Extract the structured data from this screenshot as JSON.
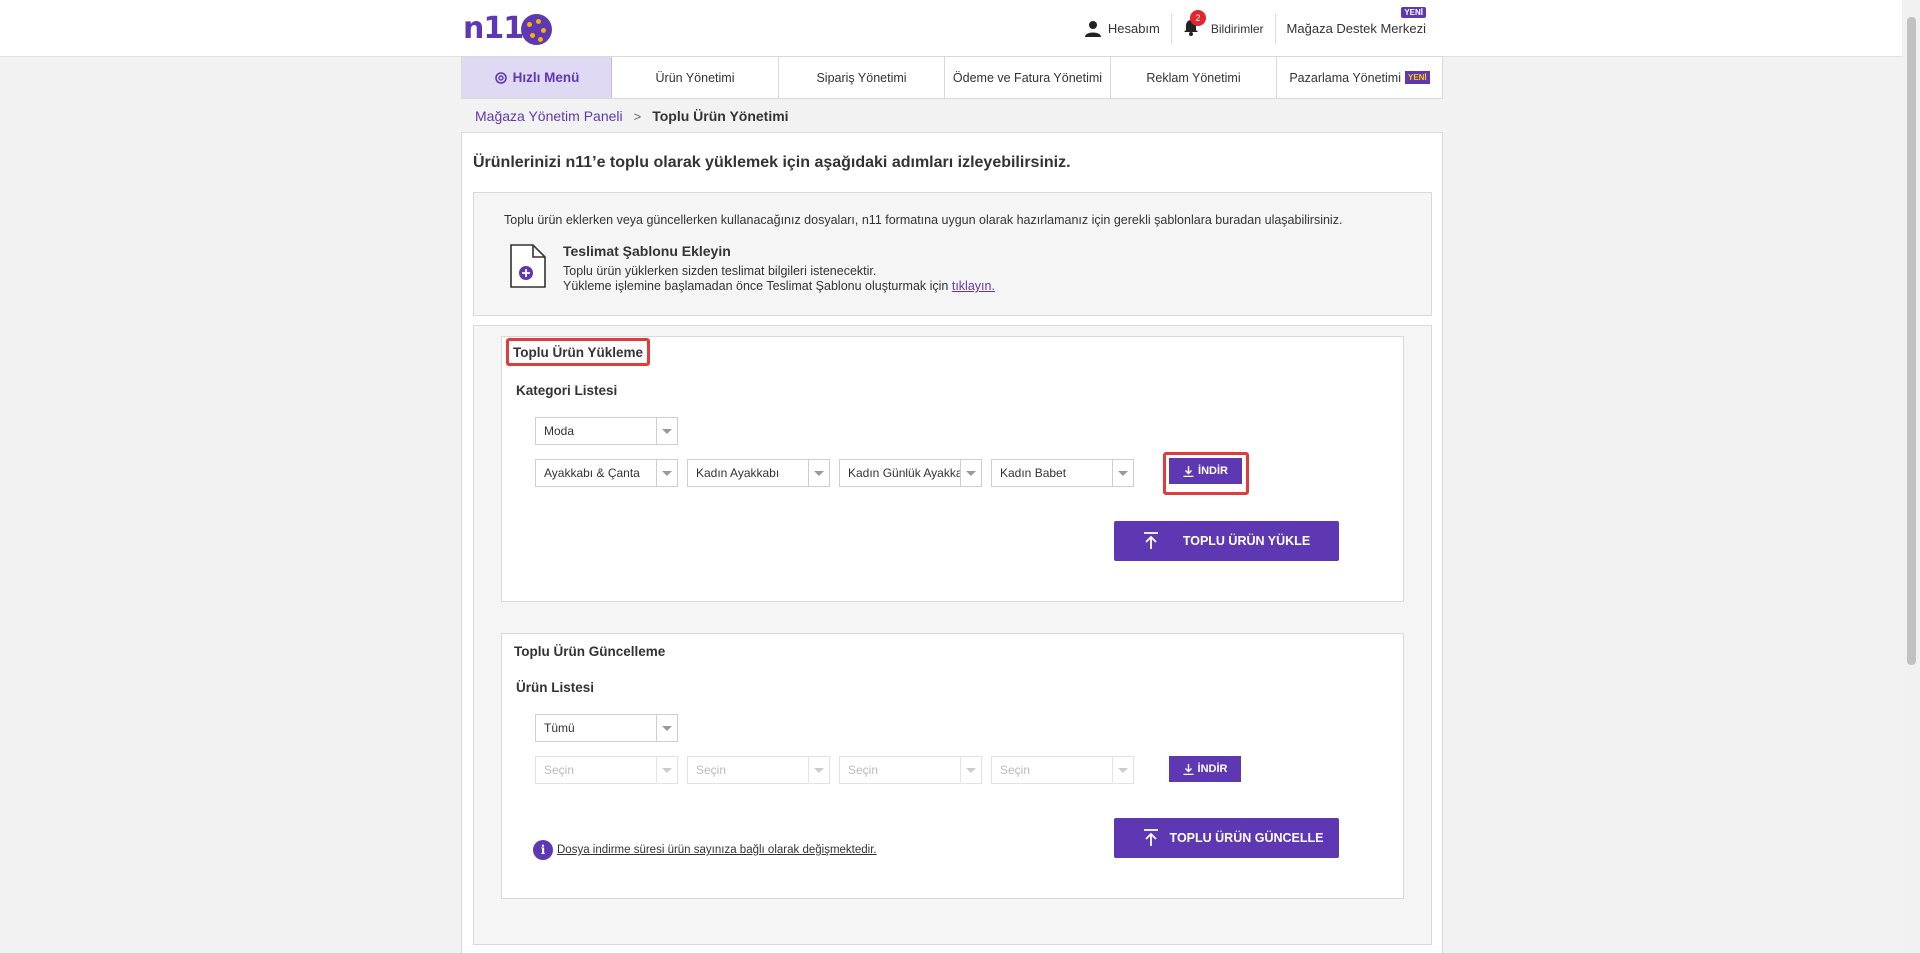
{
  "header": {
    "logo": "n11",
    "account_label": "Hesabım",
    "notif_count": "2",
    "notif_label": "Bildirimler",
    "store_support_label": "Mağaza Destek Merkezi",
    "store_support_badge": "YENİ"
  },
  "nav": {
    "quick_menu": "Hızlı Menü",
    "items": [
      {
        "label": "Ürün Yönetimi"
      },
      {
        "label": "Sipariş Yönetimi"
      },
      {
        "label": "Ödeme ve Fatura Yönetimi"
      },
      {
        "label": "Reklam Yönetimi"
      },
      {
        "label": "Pazarlama Yönetimi",
        "badge": "YENİ"
      }
    ]
  },
  "breadcrumb": {
    "root": "Mağaza Yönetim Paneli",
    "separator": ">",
    "current": "Toplu Ürün Yönetimi"
  },
  "page": {
    "heading": "Ürünlerinizi n11’e toplu olarak yüklemek için aşağıdaki adımları izleyebilirsiniz."
  },
  "info_box": {
    "text": "Toplu ürün eklerken veya güncellerken kullanacağınız dosyaları, n11 formatına uygun olarak hazırlamanız için gerekli şablonlara buradan ulaşabilirsiniz.",
    "template_title": "Teslimat Şablonu Ekleyin",
    "template_desc_1": "Toplu ürün yüklerken sizden teslimat bilgileri istenecektir.",
    "template_desc_2": "Yükleme işlemine başlamadan önce Teslimat Şablonu oluşturmak için ",
    "template_link": "tıklayın."
  },
  "upload": {
    "title": "Toplu Ürün Yükleme",
    "subtitle": "Kategori Listesi",
    "select_main": "Moda",
    "selects": [
      "Ayakkabı & Çanta",
      "Kadın Ayakkabı",
      "Kadın Günlük Ayakkabı",
      "Kadın Babet"
    ],
    "download_label": "İNDİR",
    "upload_button": "TOPLU ÜRÜN YÜKLE"
  },
  "update": {
    "title": "Toplu Ürün Güncelleme",
    "subtitle": "Ürün Listesi",
    "select_main": "Tümü",
    "selects": [
      "Seçin",
      "Seçin",
      "Seçin",
      "Seçin"
    ],
    "download_label": "İNDİR",
    "update_button": "TOPLU ÜRÜN GÜNCELLE",
    "note": "Dosya indirme süresi ürün sayınıza bağlı olarak değişmektedir."
  },
  "colors": {
    "brand": "#5e38b3",
    "highlight": "#e03c3c",
    "notif_badge": "#e3262d"
  }
}
